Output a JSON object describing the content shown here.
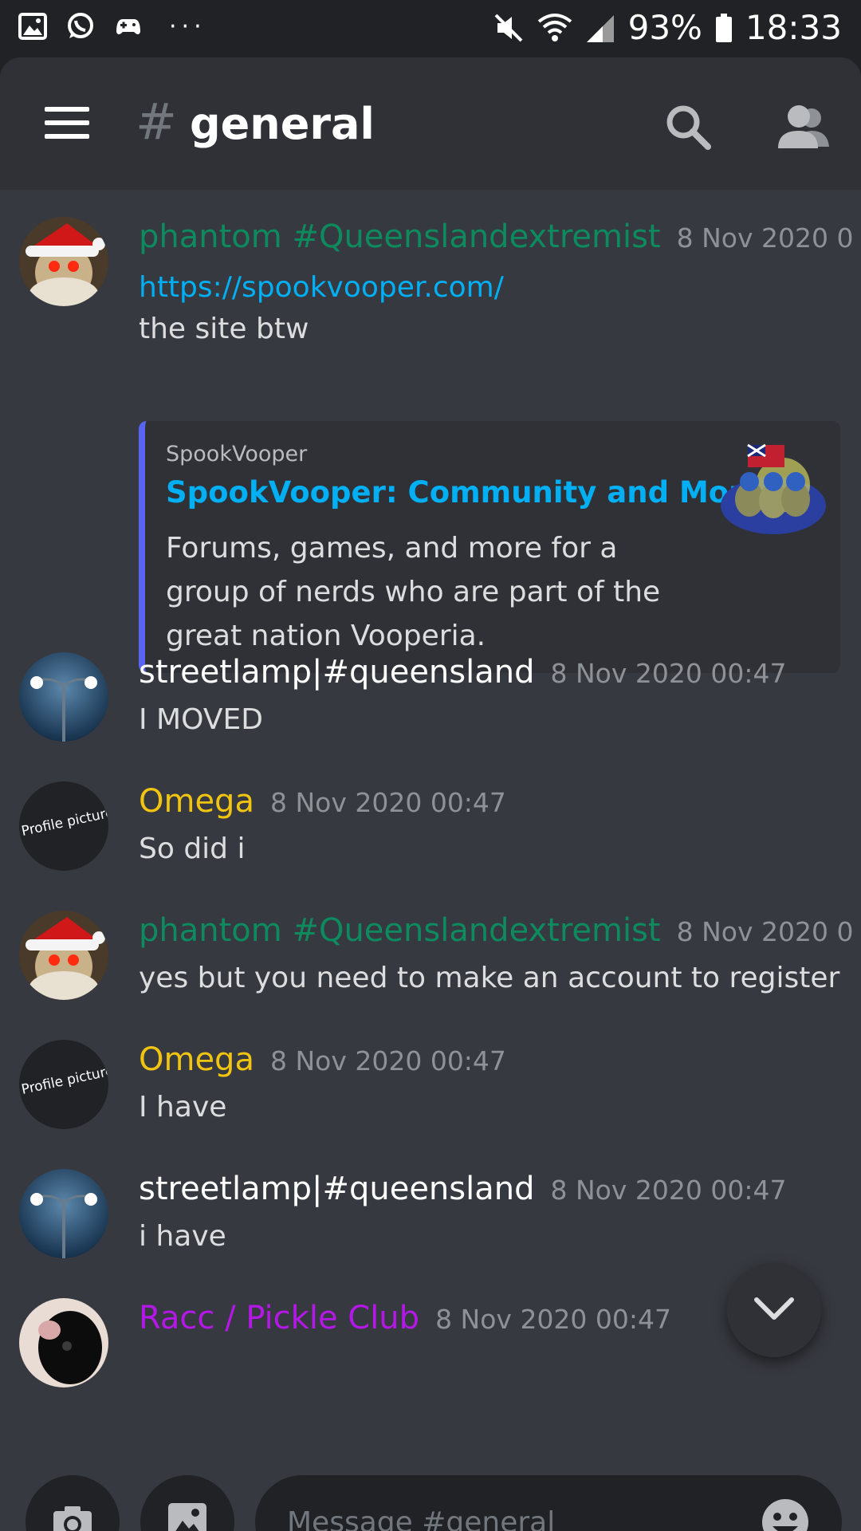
{
  "statusbar": {
    "left_icons": [
      "gallery-icon",
      "whatsapp-icon",
      "gamepad-icon"
    ],
    "dots": "···",
    "battery": "93%",
    "time": "18:33"
  },
  "header": {
    "hash": "#",
    "channel": "general"
  },
  "messages": [
    {
      "user": "phantom #Queenslandextremist",
      "user_color": "#0e8a5f",
      "timestamp": "8 Nov 2020 0",
      "avatar": "santa-avatar",
      "link": "https://spookvooper.com/",
      "text": "the site btw",
      "embed": {
        "provider": "SpookVooper",
        "title": "SpookVooper: Community and More",
        "description": "Forums, games, and more for a group of nerds who are part of the great nation Vooperia."
      }
    },
    {
      "user": "streetlamp|#queensland",
      "user_color": "#ffffff",
      "timestamp": "8 Nov 2020 00:47",
      "avatar": "streetlamp-avatar",
      "text": "I MOVED"
    },
    {
      "user": "Omega",
      "user_color": "#f1c40f",
      "timestamp": "8 Nov 2020 00:47",
      "avatar": "profile-picture-avatar",
      "avatar_label": "Profile picture",
      "text": "So did i"
    },
    {
      "user": "phantom #Queenslandextremist",
      "user_color": "#0e8a5f",
      "timestamp": "8 Nov 2020 0",
      "avatar": "santa-avatar",
      "text": "yes but you need to make an account to register"
    },
    {
      "user": "Omega",
      "user_color": "#f1c40f",
      "timestamp": "8 Nov 2020 00:47",
      "avatar": "profile-picture-avatar",
      "avatar_label": "Profile picture",
      "text": "I have"
    },
    {
      "user": "streetlamp|#queensland",
      "user_color": "#ffffff",
      "timestamp": "8 Nov 2020 00:47",
      "avatar": "streetlamp-avatar",
      "text": "i have"
    },
    {
      "user": "Racc / Pickle Club",
      "user_color": "#b318e6",
      "timestamp": "8 Nov 2020 00:47",
      "avatar": "racc-avatar"
    }
  ],
  "composer": {
    "placeholder": "Message #general"
  }
}
